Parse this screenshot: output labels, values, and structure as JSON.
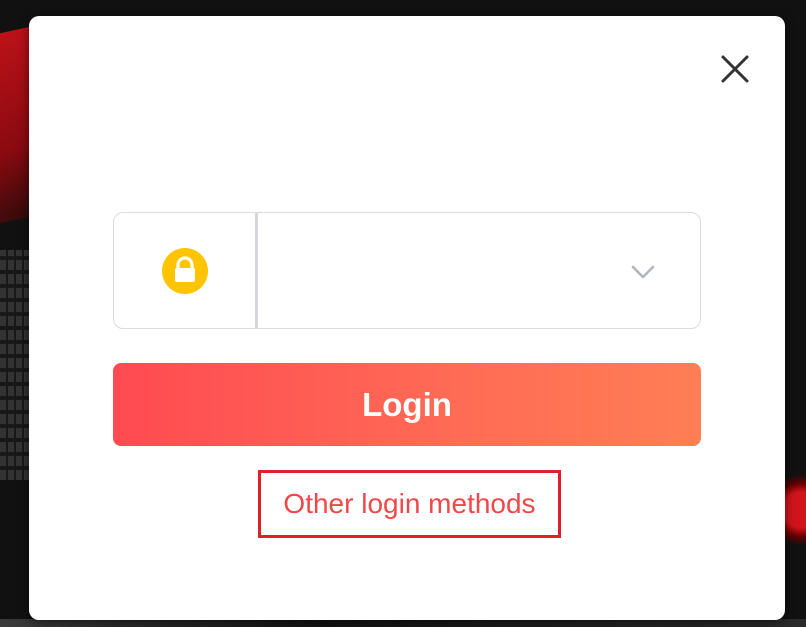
{
  "modal": {
    "close_label": "close",
    "account_field": {
      "icon": "lock-icon",
      "selected_value": "",
      "dropdown_icon": "chevron-down-icon"
    },
    "login_button": "Login",
    "other_login_methods": "Other login methods"
  },
  "colors": {
    "accent_start": "#ff4a52",
    "accent_end": "#ff7e55",
    "lock_icon": "#ffc400",
    "link_text": "#f04848",
    "highlight_box": "#e02027"
  }
}
